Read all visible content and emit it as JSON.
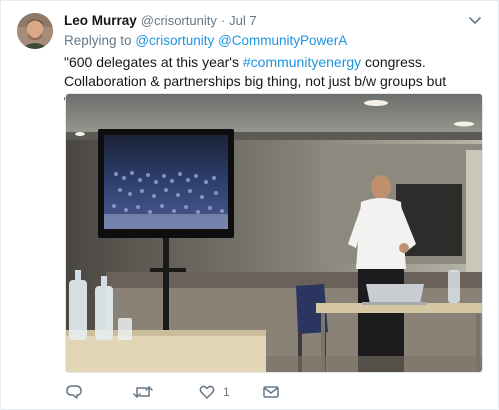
{
  "tweet": {
    "author_name": "Leo Murray",
    "author_handle": "@crisortunity",
    "separator": "·",
    "timestamp": "Jul 7",
    "replying_prefix": "Replying to",
    "reply_mentions": [
      "@crisortunity",
      "@CommunityPowerA"
    ],
    "text_before": "\"600 delegates at this year's ",
    "hashtag": "#communityenergy",
    "text_after": " congress. Collaboration & partnerships big thing, not just b/w groups but with industry too\"",
    "media": {
      "alt": "photo"
    }
  },
  "actions": {
    "reply_icon": "reply-icon",
    "retweet_icon": "retweet-icon",
    "like_icon": "heart-icon",
    "like_count": "1",
    "message_icon": "envelope-icon"
  },
  "colors": {
    "link": "#1b95e0",
    "secondary_text": "#657786",
    "primary_text": "#14171a"
  }
}
